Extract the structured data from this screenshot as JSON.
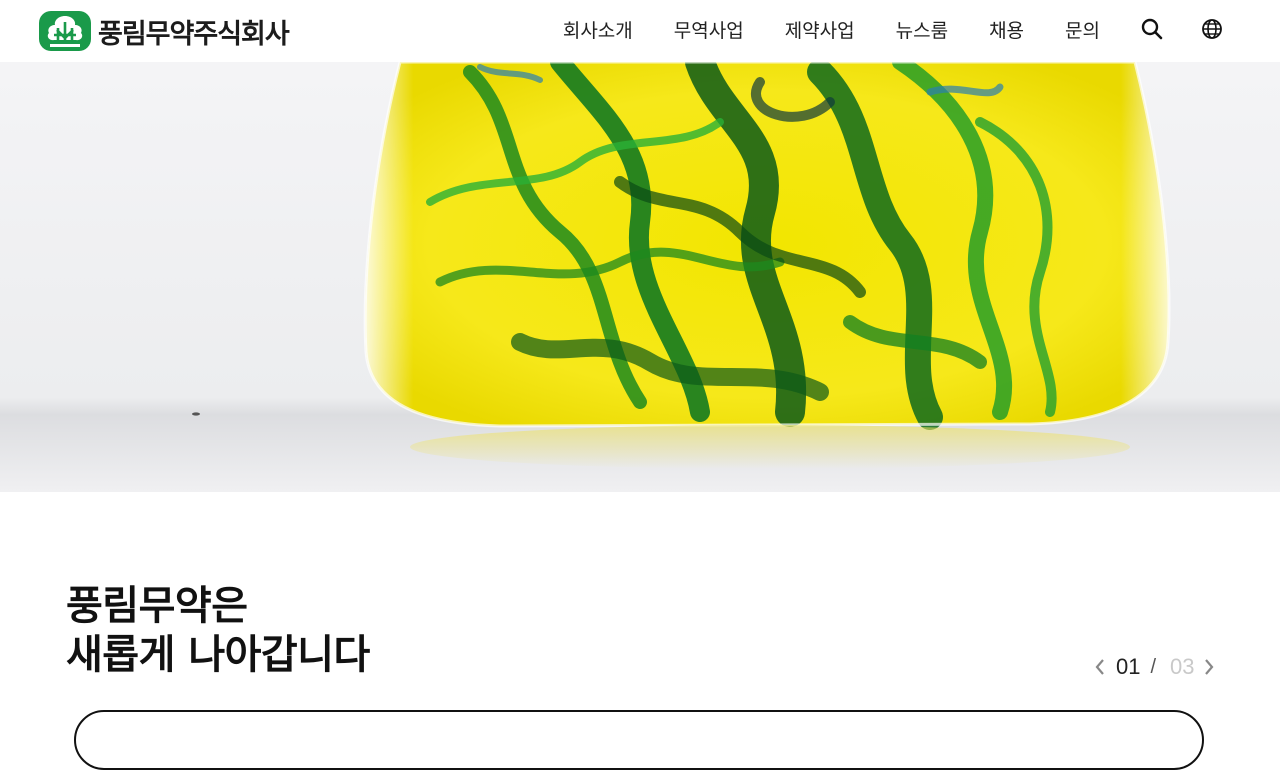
{
  "header": {
    "logo_text": "풍림무약주식회사",
    "logo_icon": "tree-emblem-icon",
    "brand_color": "#1a9a4a",
    "nav": [
      {
        "label": "회사소개"
      },
      {
        "label": "무역사업"
      },
      {
        "label": "제약사업"
      },
      {
        "label": "뉴스룸"
      },
      {
        "label": "채용"
      },
      {
        "label": "문의"
      }
    ],
    "search_icon": "search-icon",
    "language_icon": "globe-icon"
  },
  "hero": {
    "image": "flask-with-yellow-and-green-ink"
  },
  "intro": {
    "line1": "풍림무약은",
    "line2": "새롭게 나아갑니다"
  },
  "pager": {
    "current": "01",
    "separator": "/",
    "total": "03",
    "prev_icon": "chevron-left-icon",
    "next_icon": "chevron-right-icon"
  }
}
